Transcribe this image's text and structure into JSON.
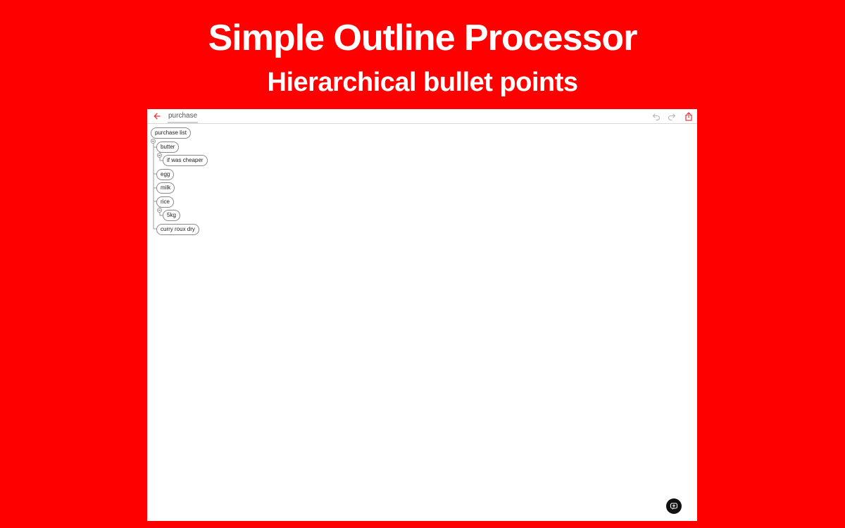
{
  "header": {
    "title": "Simple Outline Processor",
    "subtitle": "Hierarchical bullet points"
  },
  "toolbar": {
    "document_title": "purchase",
    "back_icon": "arrow-left-icon",
    "undo_icon": "undo-icon",
    "redo_icon": "redo-icon",
    "share_icon": "share-icon"
  },
  "outline": {
    "root": "purchase list",
    "items": [
      {
        "label": "butter",
        "children": [
          "if was cheaper"
        ]
      },
      {
        "label": "egg",
        "children": []
      },
      {
        "label": "milk",
        "children": []
      },
      {
        "label": "rice",
        "children": [
          "5kg"
        ]
      },
      {
        "label": "curry roux dry",
        "children": []
      }
    ]
  },
  "fab": {
    "icon": "add-note-icon"
  },
  "colors": {
    "background": "#ff0000",
    "accent": "#e53935",
    "canvas": "#ffffff"
  }
}
